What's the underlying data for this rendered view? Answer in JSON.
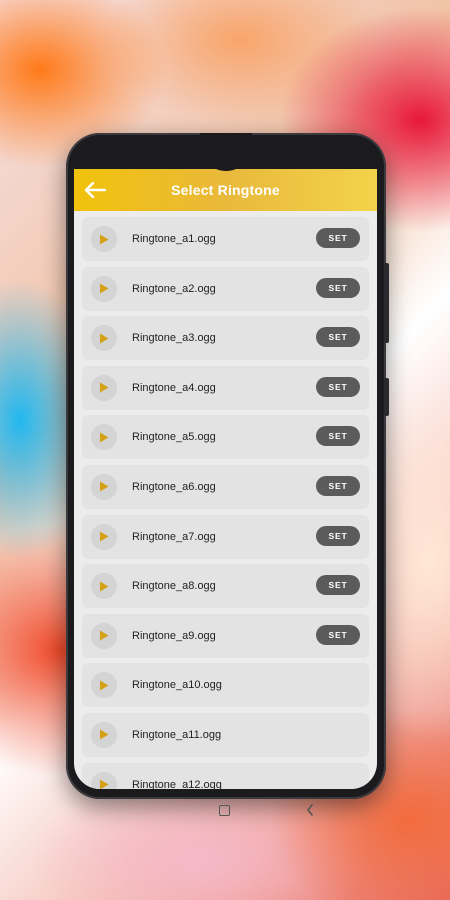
{
  "header": {
    "title": "Select Ringtone"
  },
  "set_label": "SET",
  "colors": {
    "header_gradient_start": "#f1c20c",
    "header_gradient_end": "#f3d34a",
    "play_icon": "#d4a017",
    "set_button": "#5b5b5b"
  },
  "ringtones": [
    {
      "name": "Ringtone_a1.ogg",
      "has_set": true
    },
    {
      "name": "Ringtone_a2.ogg",
      "has_set": true
    },
    {
      "name": "Ringtone_a3.ogg",
      "has_set": true
    },
    {
      "name": "Ringtone_a4.ogg",
      "has_set": true
    },
    {
      "name": "Ringtone_a5.ogg",
      "has_set": true
    },
    {
      "name": "Ringtone_a6.ogg",
      "has_set": true
    },
    {
      "name": "Ringtone_a7.ogg",
      "has_set": true
    },
    {
      "name": "Ringtone_a8.ogg",
      "has_set": true
    },
    {
      "name": "Ringtone_a9.ogg",
      "has_set": true
    },
    {
      "name": "Ringtone_a10.ogg",
      "has_set": false
    },
    {
      "name": "Ringtone_a11.ogg",
      "has_set": false
    },
    {
      "name": "Ringtone_a12.ogg",
      "has_set": false
    }
  ],
  "icons": {
    "back": "arrow-left-icon",
    "play": "play-icon",
    "home": "home-square-icon",
    "nav_back": "chevron-left-icon"
  }
}
